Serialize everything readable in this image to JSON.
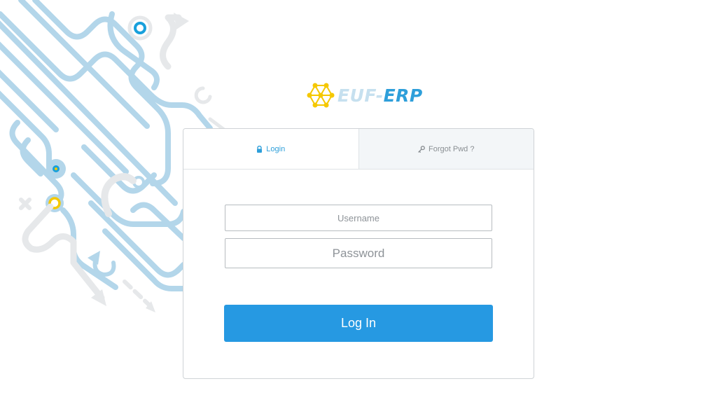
{
  "brand": {
    "name_part1": "EUF-",
    "name_part2": "ERP",
    "logo_icon": "network-hexagon-icon",
    "colors": {
      "logo_yellow": "#f5c800",
      "logo_light": "#c6e0ef",
      "logo_blue": "#2e9fda"
    }
  },
  "tabs": [
    {
      "label": "Login",
      "icon": "lock-icon",
      "active": true
    },
    {
      "label": "Forgot Pwd ?",
      "icon": "key-icon",
      "active": false
    }
  ],
  "form": {
    "username": {
      "value": "",
      "placeholder": "Username"
    },
    "password": {
      "value": "",
      "placeholder": "Password"
    },
    "submit_label": "Log In"
  },
  "colors": {
    "accent": "#2699e2",
    "decor_blue": "#b3d6ea",
    "decor_gray": "#e6e8ea"
  }
}
